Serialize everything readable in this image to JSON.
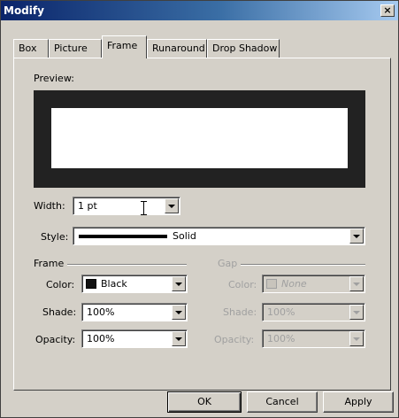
{
  "window": {
    "title": "Modify",
    "close_label": "×"
  },
  "tabs": [
    {
      "label": "Box",
      "active": false
    },
    {
      "label": "Picture",
      "active": false
    },
    {
      "label": "Frame",
      "active": true
    },
    {
      "label": "Runaround",
      "active": false
    },
    {
      "label": "Drop Shadow",
      "active": false
    }
  ],
  "preview": {
    "label": "Preview:"
  },
  "width": {
    "label": "Width:",
    "value": "1 pt"
  },
  "style": {
    "label": "Style:",
    "value": "Solid"
  },
  "frame": {
    "title": "Frame",
    "color": {
      "label": "Color:",
      "value": "Black",
      "swatch": "#111111"
    },
    "shade": {
      "label": "Shade:",
      "value": "100%"
    },
    "opacity": {
      "label": "Opacity:",
      "value": "100%"
    }
  },
  "gap": {
    "title": "Gap",
    "color": {
      "label": "Color:",
      "value": "None"
    },
    "shade": {
      "label": "Shade:",
      "value": "100%"
    },
    "opacity": {
      "label": "Opacity:",
      "value": "100%"
    }
  },
  "buttons": {
    "ok": "OK",
    "cancel": "Cancel",
    "apply": "Apply"
  },
  "colors": {
    "title_bar": "#0a246a",
    "dialog_bg": "#d4d0c8",
    "preview_frame": "#222222"
  }
}
